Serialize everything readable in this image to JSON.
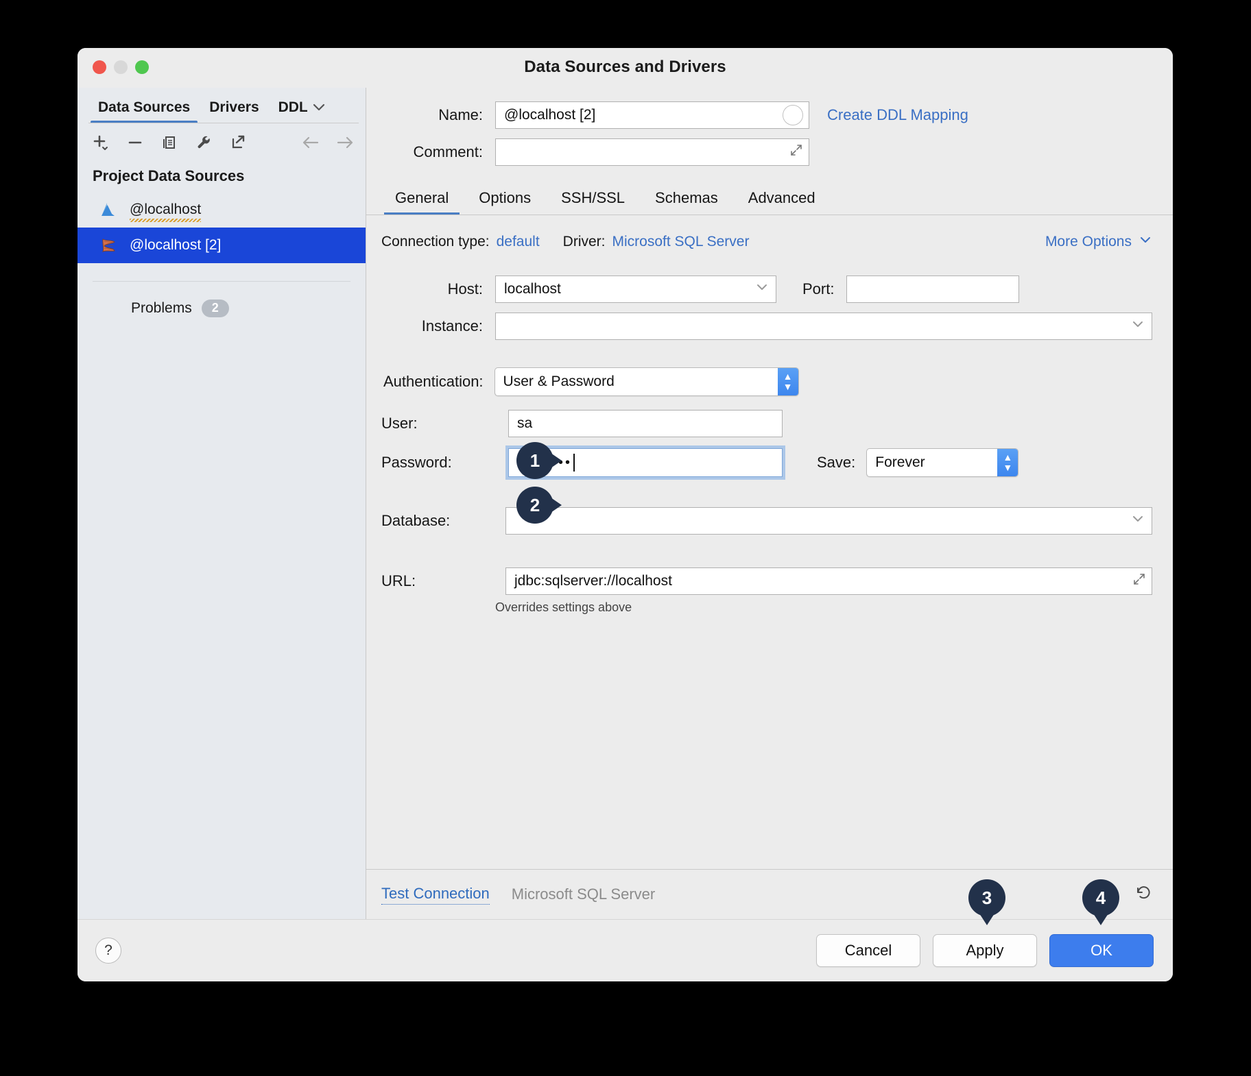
{
  "window": {
    "title": "Data Sources and Drivers",
    "traffic_lights": [
      "close-button",
      "minimize-button",
      "maximize-button"
    ]
  },
  "sidebar": {
    "tabs": [
      {
        "label": "Data Sources",
        "active": true
      },
      {
        "label": "Drivers",
        "active": false
      },
      {
        "label": "DDL Mappings",
        "active": false,
        "clipped": true
      }
    ],
    "overflow_icon": "chevron-down-icon",
    "toolbar": [
      {
        "name": "add-icon",
        "glyph": "+"
      },
      {
        "name": "remove-icon",
        "glyph": "−"
      },
      {
        "name": "copy-icon",
        "glyph": "⎘"
      },
      {
        "name": "wrench-icon",
        "glyph": "🔧"
      },
      {
        "name": "share-icon",
        "glyph": "↗"
      }
    ],
    "nav_back_icon": "arrow-left-icon",
    "nav_forward_icon": "arrow-right-icon",
    "group_label": "Project Data Sources",
    "items": [
      {
        "label": "@localhost",
        "icon": "azure-sql-icon",
        "selected": false,
        "warning": true
      },
      {
        "label": "@localhost [2]",
        "icon": "microsoft-sql-server-icon",
        "selected": true,
        "warning": false
      }
    ],
    "problems": {
      "label": "Problems",
      "count": "2"
    }
  },
  "form": {
    "name_label": "Name:",
    "name_value": "@localhost [2]",
    "name_color_indicator": "empty-circle-icon",
    "create_ddl_link": "Create DDL Mapping",
    "comment_label": "Comment:",
    "comment_value": "",
    "comment_expand_icon": "expand-icon"
  },
  "tabs": [
    {
      "label": "General",
      "active": true
    },
    {
      "label": "Options",
      "active": false
    },
    {
      "label": "SSH/SSL",
      "active": false
    },
    {
      "label": "Schemas",
      "active": false
    },
    {
      "label": "Advanced",
      "active": false
    }
  ],
  "general": {
    "connection_type_label": "Connection type:",
    "connection_type_value": "default",
    "driver_label": "Driver:",
    "driver_value": "Microsoft SQL Server",
    "more_options_label": "More Options",
    "more_options_icon": "chevron-down-icon",
    "host_label": "Host:",
    "host_value": "localhost",
    "port_label": "Port:",
    "port_value": "",
    "instance_label": "Instance:",
    "instance_value": "",
    "authentication_label": "Authentication:",
    "authentication_value": "User & Password",
    "user_label": "User:",
    "user_value": "sa",
    "password_label": "Password:",
    "password_value": "••••••••",
    "save_label": "Save:",
    "save_value": "Forever",
    "database_label": "Database:",
    "database_value": "",
    "url_label": "URL:",
    "url_value": "jdbc:sqlserver://localhost",
    "url_expand_icon": "expand-icon",
    "url_hint": "Overrides settings above"
  },
  "testbar": {
    "test_connection_label": "Test Connection",
    "driver_note": "Microsoft SQL Server",
    "revert_icon": "revert-icon"
  },
  "footer": {
    "help_label": "?",
    "cancel_label": "Cancel",
    "apply_label": "Apply",
    "ok_label": "OK"
  },
  "callouts": [
    {
      "number": "1",
      "target": "user-field"
    },
    {
      "number": "2",
      "target": "password-field"
    },
    {
      "number": "3",
      "target": "apply-button"
    },
    {
      "number": "4",
      "target": "ok-button"
    }
  ],
  "colors": {
    "accent_blue": "#3d7ded",
    "selection_blue": "#1a46d8",
    "link_blue": "#3a6fc4",
    "callout_navy": "#22314a",
    "window_bg": "#ececec",
    "sidebar_bg": "#e7eaee"
  }
}
